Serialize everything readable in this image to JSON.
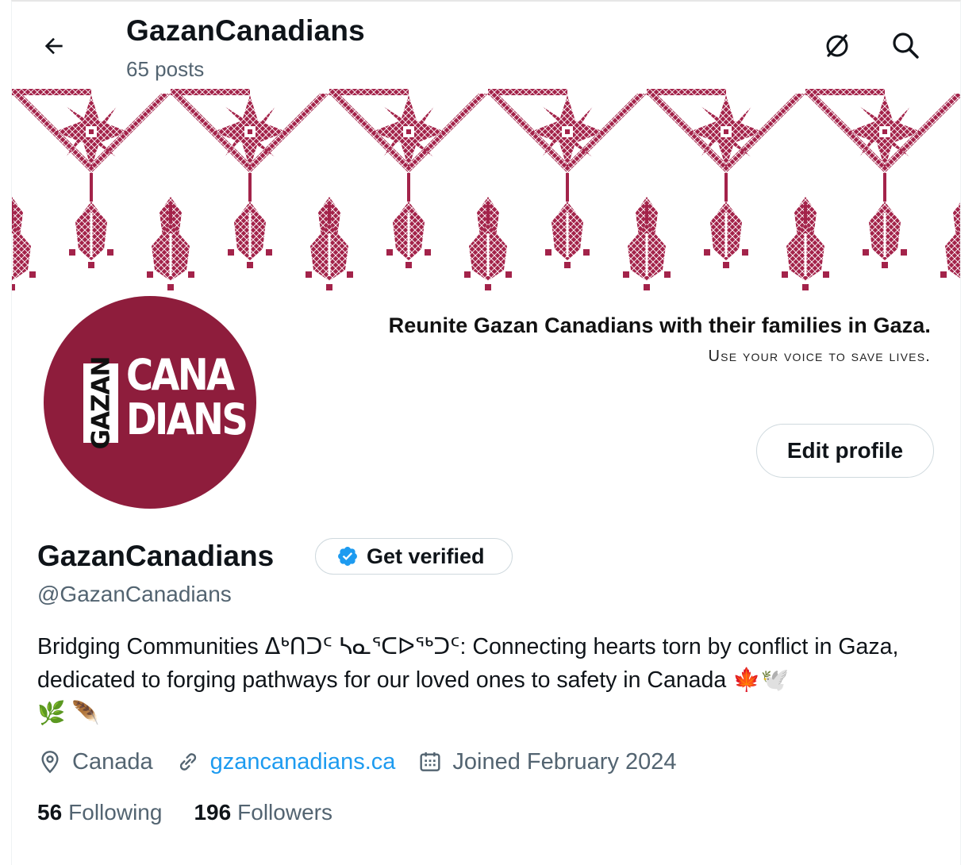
{
  "header": {
    "title": "GazanCanadians",
    "posts": "65 posts"
  },
  "banner": {
    "headline": "Reunite Gazan Canadians with their families in Gaza.",
    "subline": "Use your voice to save lives.",
    "pattern_color": "#a3234a"
  },
  "avatar": {
    "vertical_word": "GAZAN",
    "line1": "CANA",
    "line2": "DIANS",
    "bg_color": "#8e1d3c"
  },
  "actions": {
    "edit_profile": "Edit profile"
  },
  "profile": {
    "name": "GazanCanadians",
    "verify_label": "Get verified",
    "handle": "@GazanCanadians",
    "bio_text": "Bridging Communities ᐃᒃᑎᑐᑦ ᓴᓇᕐᑕᐅᖅᑐᑦ: Connecting hearts torn by conflict in Gaza, dedicated to forging pathways for our loved ones to safety in Canada",
    "bio_emoji_1": "🍁",
    "bio_emoji_2": "🕊️",
    "bio_emoji_3": "🌿",
    "bio_emoji_4": "🪶",
    "location": "Canada",
    "website": "gzancanadians.ca",
    "joined": "Joined February 2024",
    "following_count": "56",
    "following_label": "Following",
    "followers_count": "196",
    "followers_label": "Followers"
  },
  "colors": {
    "accent": "#1d9bf0",
    "text_secondary": "#536471"
  }
}
